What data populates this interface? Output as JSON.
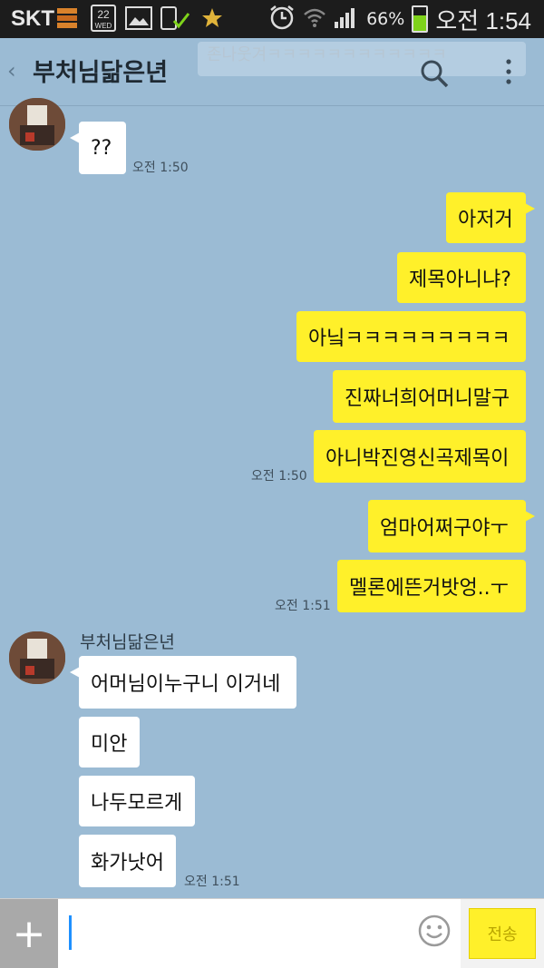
{
  "status_bar": {
    "carrier": "SKT",
    "calendar_day": "22",
    "calendar_weekday": "WED",
    "battery_percent": "66%",
    "battery_level": 0.66,
    "time": "오전 1:54"
  },
  "header": {
    "back_glyph": "‹",
    "title": "부처님닮은년",
    "search_icon": "search-icon",
    "menu_icon": "more-vert-icon",
    "ghost_preview": "존나웃겨ㅋㅋㅋㅋㅋㅋㅋㅋㅋㅋㅋㅋ",
    "ghost_name": "부처님닮은년"
  },
  "messages": {
    "m1": "??",
    "t1": "오전 1:50",
    "o1": "아저거",
    "o2": "제목아니냐?",
    "o3": "아닠ㅋㅋㅋㅋㅋㅋㅋㅋㅋ",
    "o4": "진짜너희어머니말구",
    "o5": "아니박진영신곡제목이",
    "t2": "오전 1:50",
    "o6": "엄마어쩌구야ㅜ",
    "o7": "멜론에뜬거밧엉..ㅜ",
    "t3": "오전 1:51",
    "sender_name": "부처님닮은년",
    "m2": "어머님이누구니 이거네",
    "m3": "미안",
    "m4": "나두모르게",
    "m5": "화가낫어",
    "t4": "오전 1:51"
  },
  "input_bar": {
    "plus": "+",
    "send_label": "전송",
    "emoji_icon": "smiley-icon"
  },
  "colors": {
    "chat_bg": "#9bbbd4",
    "outgoing_bubble": "#fff02a",
    "incoming_bubble": "#ffffff"
  }
}
